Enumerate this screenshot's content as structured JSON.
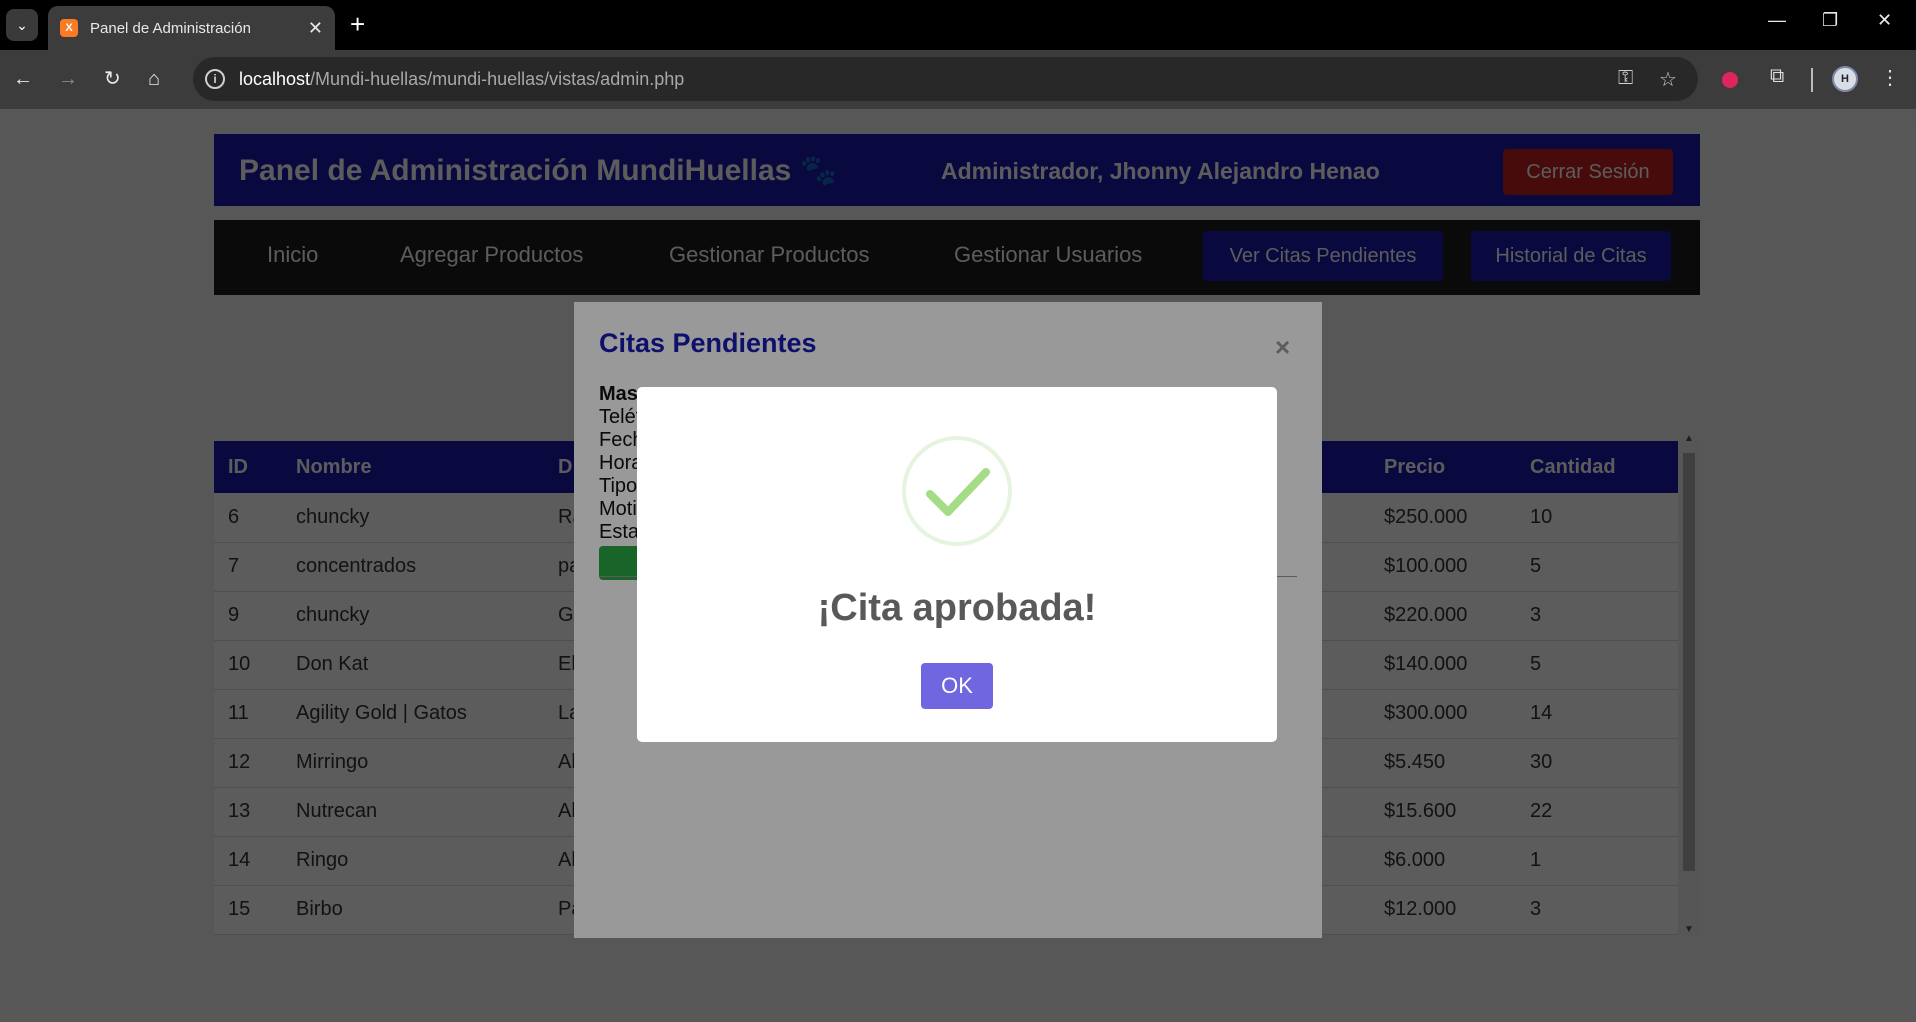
{
  "browser": {
    "tab_title": "Panel de Administración",
    "tab_favicon_text": "X",
    "url_host": "localhost",
    "url_path": "/Mundi-huellas/mundi-huellas/vistas/admin.php",
    "avatar_text": "H"
  },
  "header": {
    "title": "Panel de Administración MundiHuellas 🐾",
    "admin_label": "Administrador, Jhonny Alejandro Henao",
    "logout_label": "Cerrar Sesión"
  },
  "nav": {
    "items": [
      "Inicio",
      "Agregar Productos",
      "Gestionar Productos",
      "Gestionar Usuarios"
    ],
    "pending_label": "Ver Citas Pendientes",
    "history_label": "Historial de Citas"
  },
  "table": {
    "columns": [
      "ID",
      "Nombre",
      "D",
      "Precio",
      "Cantidad"
    ],
    "rows": [
      [
        "6",
        "chuncky",
        "Ra",
        "$250.000",
        "10"
      ],
      [
        "7",
        "concentrados",
        "pa",
        "$100.000",
        "5"
      ],
      [
        "9",
        "chuncky",
        "Gl",
        "$220.000",
        "3"
      ],
      [
        "10",
        "Don Kat",
        "El",
        "$140.000",
        "5"
      ],
      [
        "11",
        "Agility Gold | Gatos",
        "La",
        "$300.000",
        "14"
      ],
      [
        "12",
        "Mirringo",
        "Al",
        "$5.450",
        "30"
      ],
      [
        "13",
        "Nutrecan",
        "Al",
        "$15.600",
        "22"
      ],
      [
        "14",
        "Ringo",
        "Al",
        "$6.000",
        "1"
      ],
      [
        "15",
        "Birbo",
        "Pa",
        "$12.000",
        "3"
      ]
    ]
  },
  "modal": {
    "title": "Citas Pendientes",
    "close": "×",
    "lines": [
      "Mas",
      "Teléf",
      "Fech",
      "Hora",
      "Tipo",
      "Moti",
      "Esta"
    ]
  },
  "alert": {
    "title": "¡Cita aprobada!",
    "ok_label": "OK",
    "success_color": "#a5dc86",
    "button_color": "#7066e0"
  },
  "colors": {
    "brand_blue": "#1a1ab4",
    "logout_red": "#c82020",
    "approve_green": "#28a745"
  }
}
